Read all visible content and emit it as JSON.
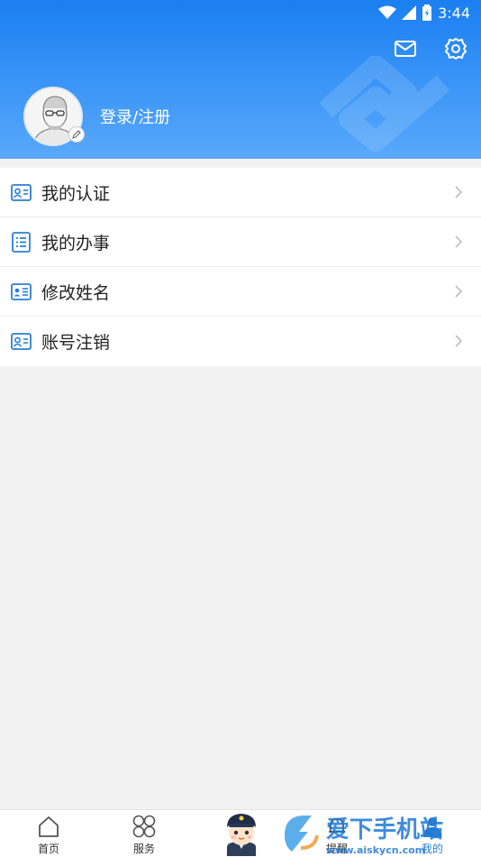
{
  "status_bar": {
    "time": "3:44"
  },
  "header": {
    "login_label": "登录/注册",
    "mail_icon": "mail-icon",
    "settings_icon": "settings-icon"
  },
  "menu": {
    "items": [
      {
        "label": "我的认证",
        "icon": "id-card-icon"
      },
      {
        "label": "我的办事",
        "icon": "list-icon"
      },
      {
        "label": "修改姓名",
        "icon": "name-card-icon"
      },
      {
        "label": "账号注销",
        "icon": "account-card-icon"
      }
    ]
  },
  "tabbar": {
    "tabs": [
      {
        "label": "首页",
        "icon": "home-icon"
      },
      {
        "label": "服务",
        "icon": "grid-icon"
      },
      {
        "label": "提醒",
        "icon": "bell-icon"
      },
      {
        "label": "我的",
        "icon": "user-icon"
      }
    ]
  },
  "watermark": {
    "text": "爱下手机站",
    "url": "www.aiskycn.com"
  },
  "colors": {
    "header_blue": "#1b7ff0",
    "icon_blue": "#2a7fd4",
    "active_tab": "#2a7fd4"
  }
}
